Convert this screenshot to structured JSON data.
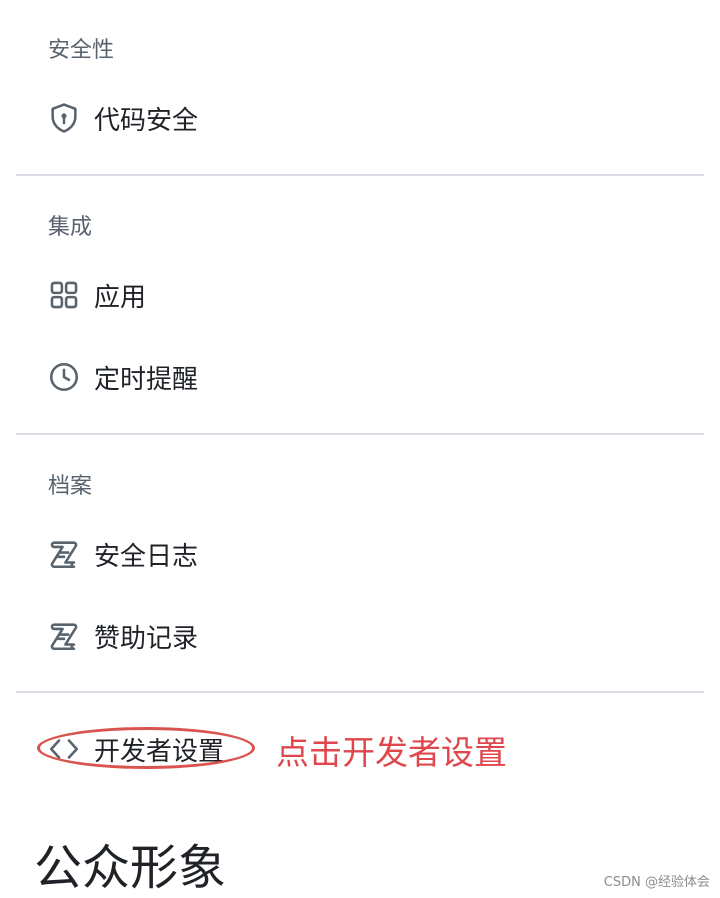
{
  "sections": {
    "security": {
      "header": "安全性",
      "items": [
        {
          "label": "代码安全",
          "icon": "shield-lock-icon"
        }
      ]
    },
    "integrations": {
      "header": "集成",
      "items": [
        {
          "label": "应用",
          "icon": "apps-grid-icon"
        },
        {
          "label": "定时提醒",
          "icon": "clock-icon"
        }
      ]
    },
    "archives": {
      "header": "档案",
      "items": [
        {
          "label": "安全日志",
          "icon": "log-icon"
        },
        {
          "label": "赞助记录",
          "icon": "log-icon"
        }
      ]
    },
    "developer": {
      "items": [
        {
          "label": "开发者设置",
          "icon": "code-icon"
        }
      ]
    }
  },
  "annotation": {
    "text": "点击开发者设置",
    "color": "#e0474c"
  },
  "page_title": "公众形象",
  "watermark": "CSDN @经验体会",
  "colors": {
    "icon": "#59636e",
    "divider": "#d8dee4",
    "header": "#59636e"
  }
}
